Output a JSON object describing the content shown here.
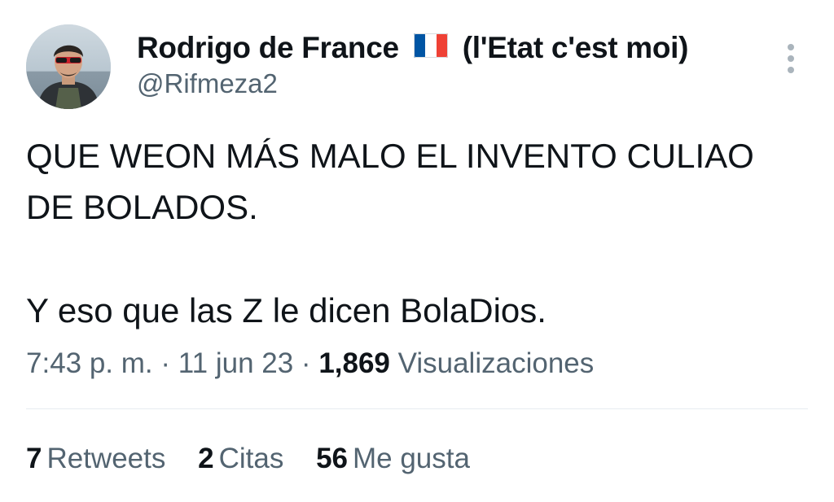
{
  "author": {
    "display_name": "Rodrigo de France",
    "flag_icon": "france-flag-icon",
    "display_name_suffix": "(l'Etat c'est moi)",
    "handle": "@Rifmeza2"
  },
  "tweet": {
    "paragraphs": [
      "QUE WEON MÁS MALO EL INVENTO CULIAO DE BOLADOS.",
      "Y eso que las Z le dicen BolaDios."
    ]
  },
  "meta": {
    "time": "7:43 p. m.",
    "separator": "·",
    "date": "11 jun 23",
    "views_count": "1,869",
    "views_label": "Visualizaciones"
  },
  "stats": {
    "retweets_count": "7",
    "retweets_label": "Retweets",
    "quotes_count": "2",
    "quotes_label": "Citas",
    "likes_count": "56",
    "likes_label": "Me gusta"
  },
  "colors": {
    "text_primary": "#0f1419",
    "text_secondary": "#536471",
    "divider": "#e6ecf0",
    "flag_blue": "#0055a4",
    "flag_red": "#ef4135"
  }
}
